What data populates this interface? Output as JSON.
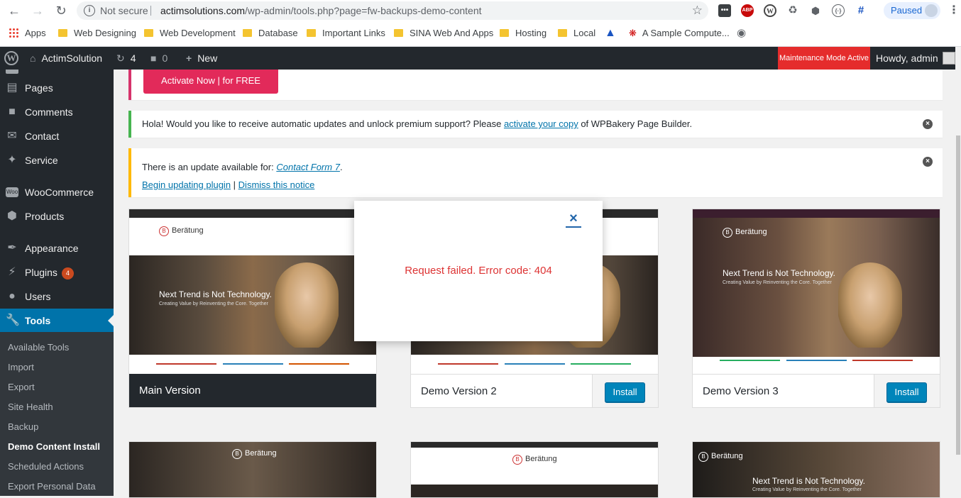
{
  "browser": {
    "omnibox": {
      "security": "Not secure",
      "host": "actimsolutions.com",
      "path": "/wp-admin/tools.php?page=fw-backups-demo-content"
    },
    "profile": {
      "status": "Paused"
    },
    "bookmarks": [
      {
        "label": "Apps",
        "icon": "apps-grid-icon"
      },
      {
        "label": "Web Designing",
        "icon": "folder-icon"
      },
      {
        "label": "Web Development",
        "icon": "folder-icon"
      },
      {
        "label": "Database",
        "icon": "folder-icon"
      },
      {
        "label": "Important Links",
        "icon": "folder-icon"
      },
      {
        "label": "SINA Web And Apps",
        "icon": "folder-icon"
      },
      {
        "label": "Hosting",
        "icon": "folder-icon"
      },
      {
        "label": "Local",
        "icon": "folder-icon"
      },
      {
        "label": "A Sample Compute...",
        "icon": "bookmark-favicon"
      }
    ]
  },
  "adminbar": {
    "site_name": "ActimSolution",
    "updates_count": "4",
    "comments_count": "0",
    "new_label": "New",
    "maintenance": "Maintenance Mode Active",
    "howdy": "Howdy, admin"
  },
  "sidebar": {
    "items": [
      {
        "label": "Pages",
        "icon": "pages-icon"
      },
      {
        "label": "Comments",
        "icon": "comments-icon"
      },
      {
        "label": "Contact",
        "icon": "mail-icon"
      },
      {
        "label": "Service",
        "icon": "pin-icon"
      },
      {
        "label": "WooCommerce",
        "icon": "woocommerce-icon"
      },
      {
        "label": "Products",
        "icon": "products-icon"
      },
      {
        "label": "Appearance",
        "icon": "brush-icon"
      },
      {
        "label": "Plugins",
        "icon": "plug-icon",
        "badge": "4"
      },
      {
        "label": "Users",
        "icon": "users-icon"
      },
      {
        "label": "Tools",
        "icon": "wrench-icon"
      }
    ],
    "submenu": [
      "Available Tools",
      "Import",
      "Export",
      "Site Health",
      "Backup",
      "Demo Content Install",
      "Scheduled Actions",
      "Export Personal Data"
    ]
  },
  "notices": {
    "activate_button": "Activate Now | for FREE",
    "wpbakery": {
      "before": "Hola! Would you like to receive automatic updates and unlock premium support? Please ",
      "link": "activate your copy",
      "after": " of WPBakery Page Builder."
    },
    "update": {
      "before": "There is an update available for: ",
      "plugin": "Contact Form 7",
      "after": ".",
      "begin": "Begin updating plugin",
      "sep": " | ",
      "dismiss": "Dismiss this notice"
    }
  },
  "demos": {
    "thumb_text": {
      "brand": "Berätung",
      "hero_title": "Next Trend is Not Technology.",
      "hero_sub": "Creating Value by Reinventing the Core. Together"
    },
    "cards": [
      {
        "name": "Main Version"
      },
      {
        "name": "Demo Version 2",
        "install": "Install"
      },
      {
        "name": "Demo Version 3",
        "install": "Install"
      }
    ]
  },
  "modal": {
    "close": "×",
    "message": "Request failed. Error code: 404"
  },
  "colors": {
    "accent": "#0073aa",
    "error": "#dd3333",
    "maintenance": "#e52c2c",
    "activate": "#e22a5a"
  }
}
